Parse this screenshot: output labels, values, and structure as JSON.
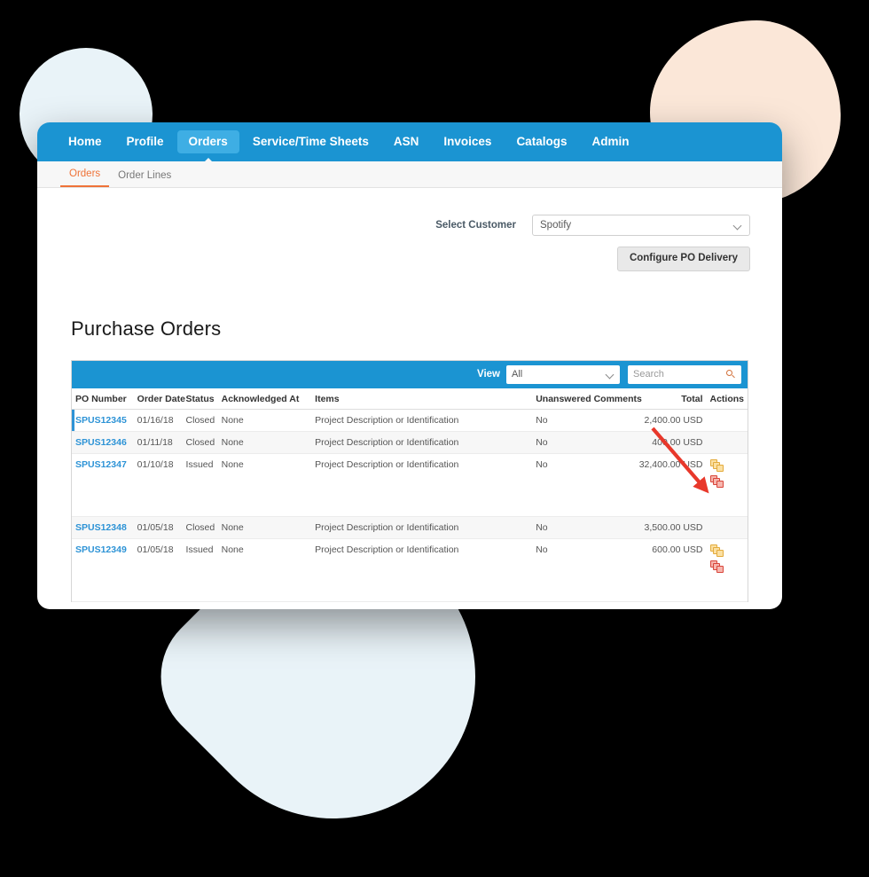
{
  "topnav": {
    "items": [
      {
        "label": "Home",
        "active": false
      },
      {
        "label": "Profile",
        "active": false
      },
      {
        "label": "Orders",
        "active": true
      },
      {
        "label": "Service/Time Sheets",
        "active": false
      },
      {
        "label": "ASN",
        "active": false
      },
      {
        "label": "Invoices",
        "active": false
      },
      {
        "label": "Catalogs",
        "active": false
      },
      {
        "label": "Admin",
        "active": false
      }
    ]
  },
  "subnav": {
    "items": [
      {
        "label": "Orders",
        "active": true
      },
      {
        "label": "Order Lines",
        "active": false
      }
    ]
  },
  "customer": {
    "label": "Select Customer",
    "selected": "Spotify",
    "configure_button": "Configure PO Delivery"
  },
  "page": {
    "title": "Purchase Orders"
  },
  "toolbar": {
    "view_label": "View",
    "view_selected": "All",
    "search_placeholder": "Search"
  },
  "table": {
    "columns": [
      "PO Number",
      "Order Date",
      "Status",
      "Acknowledged At",
      "Items",
      "Unanswered Comments",
      "Total",
      "Actions"
    ],
    "rows": [
      {
        "po_number": "SPUS12345",
        "order_date": "01/16/18",
        "status": "Closed",
        "acknowledged_at": "None",
        "items": "Project Description or Identification",
        "unanswered_comments": "No",
        "total": "2,400.00 USD",
        "has_actions": false
      },
      {
        "po_number": "SPUS12346",
        "order_date": "01/11/18",
        "status": "Closed",
        "acknowledged_at": "None",
        "items": "Project Description or Identification",
        "unanswered_comments": "No",
        "total": "400.00 USD",
        "has_actions": false
      },
      {
        "po_number": "SPUS12347",
        "order_date": "01/10/18",
        "status": "Issued",
        "acknowledged_at": "None",
        "items": "Project Description or Identification",
        "unanswered_comments": "No",
        "total": "32,400.00 USD",
        "has_actions": true
      },
      {
        "po_number": "SPUS12348",
        "order_date": "01/05/18",
        "status": "Closed",
        "acknowledged_at": "None",
        "items": "Project Description or Identification",
        "unanswered_comments": "No",
        "total": "3,500.00 USD",
        "has_actions": false
      },
      {
        "po_number": "SPUS12349",
        "order_date": "01/05/18",
        "status": "Issued",
        "acknowledged_at": "None",
        "items": "Project Description or Identification",
        "unanswered_comments": "No",
        "total": "600.00 USD",
        "has_actions": true
      }
    ]
  },
  "colors": {
    "brand_blue": "#1b94d2",
    "active_tab_blue": "#3eaee4",
    "link_blue": "#2d93d6",
    "subnav_active_orange": "#ef7338",
    "annotation_red": "#e8382b",
    "blob_blue": "#e9f3f8",
    "blob_peach": "#fbe7d8"
  }
}
